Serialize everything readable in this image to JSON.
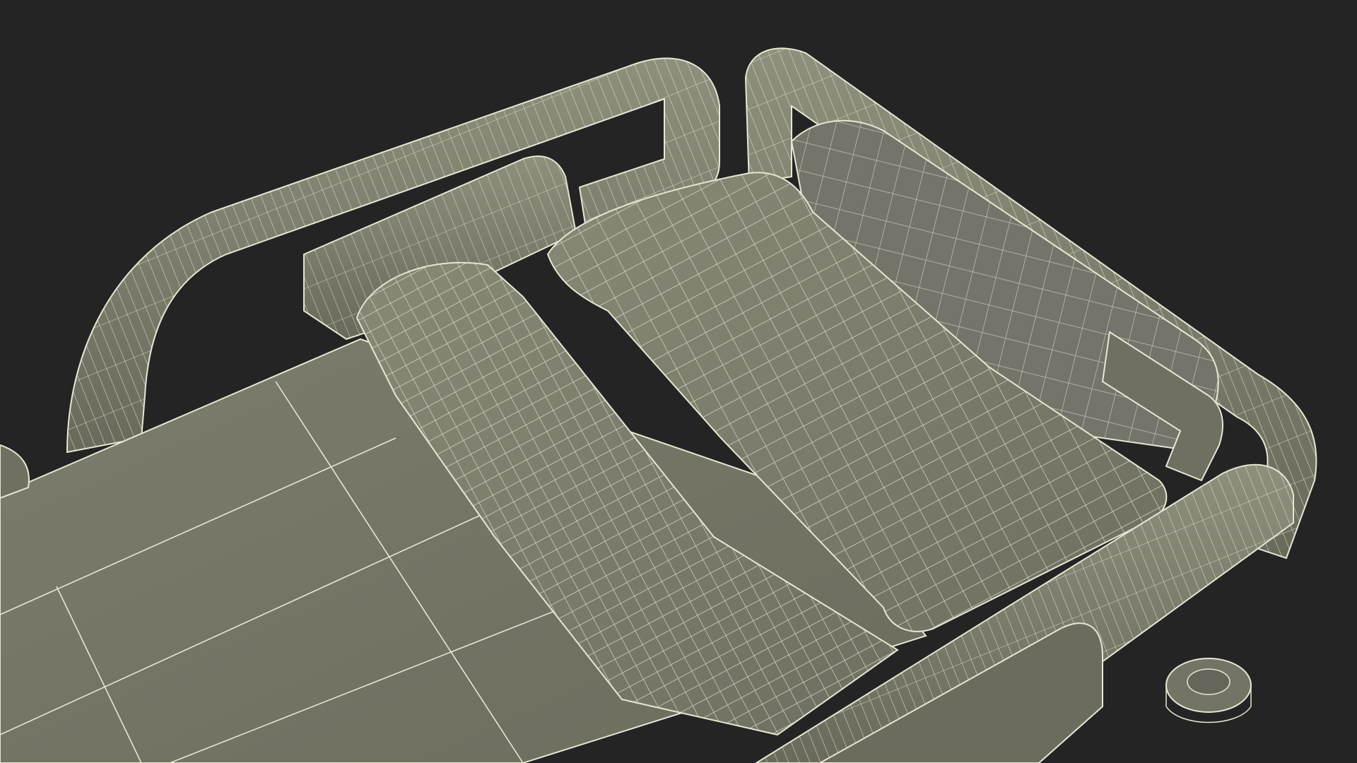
{
  "scene": {
    "subject": "hospital-bed-wireframe-render",
    "colors": {
      "background": "#242424",
      "mesh_fill": "#7a7a6a",
      "mesh_fill_dark": "#5f5f52",
      "mesh_fill_light": "#8a8a78",
      "wire": "#e8e6d2"
    },
    "parts": [
      "head-rail",
      "headboard",
      "pillow",
      "pillow-roll",
      "mattress",
      "side-rail",
      "caster"
    ]
  }
}
